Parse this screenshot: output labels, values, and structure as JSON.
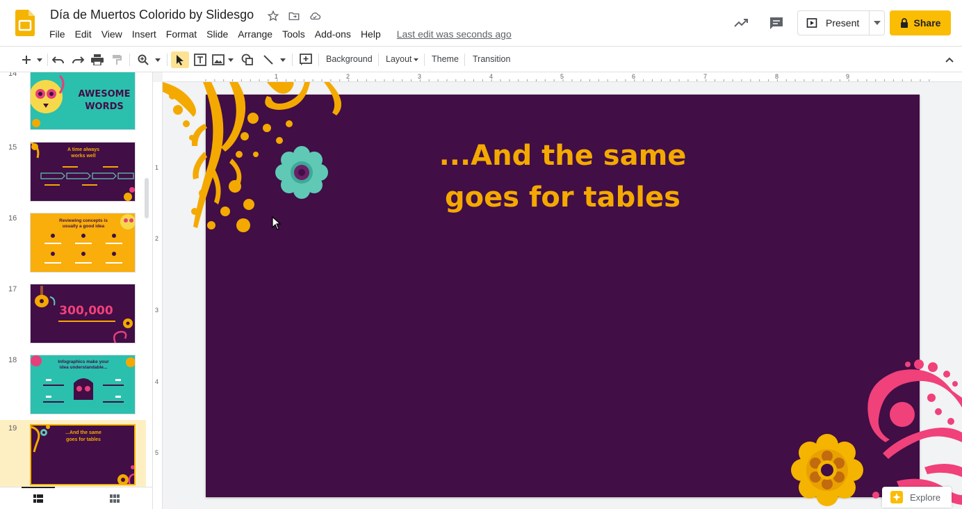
{
  "app": {
    "doc_title": "Día de Muertos Colorido by Slidesgo",
    "last_edit": "Last edit was seconds ago"
  },
  "menu": [
    "File",
    "Edit",
    "View",
    "Insert",
    "Format",
    "Slide",
    "Arrange",
    "Tools",
    "Add-ons",
    "Help"
  ],
  "header_buttons": {
    "present_label": "Present",
    "share_label": "Share"
  },
  "toolbar": {
    "background_label": "Background",
    "layout_label": "Layout",
    "theme_label": "Theme",
    "transition_label": "Transition"
  },
  "filmstrip": {
    "slides": [
      {
        "number": "14",
        "thumb_text": "AWESOME WORDS",
        "bg": "#2bbfae"
      },
      {
        "number": "15",
        "thumb_text": "A time always works well",
        "bg": "#410e46"
      },
      {
        "number": "16",
        "thumb_text": "Reviewing concepts is usually a good idea",
        "bg": "#f9ae0b"
      },
      {
        "number": "17",
        "thumb_text": "300,000",
        "bg": "#410e46"
      },
      {
        "number": "18",
        "thumb_text": "Infographics make your idea understandable...",
        "bg": "#2bbfae"
      },
      {
        "number": "19",
        "thumb_text": "...And the same goes for tables",
        "bg": "#410e46"
      }
    ],
    "active_slide": "19"
  },
  "rulers": {
    "horizontal": [
      "1",
      "2",
      "3",
      "4",
      "5",
      "6",
      "7",
      "8",
      "9"
    ],
    "vertical": [
      "1",
      "2",
      "3",
      "4",
      "5"
    ]
  },
  "slide": {
    "title_line1": "...And the same",
    "title_line2": "goes for tables",
    "bg_color": "#410e46",
    "title_color": "#f4a900"
  },
  "explore": {
    "label": "Explore"
  },
  "colors": {
    "accent_yellow": "#fbbc04",
    "slide_purple": "#410e46",
    "marigold": "#f4a900",
    "teal": "#5fc9b6",
    "pink": "#f0417a"
  }
}
